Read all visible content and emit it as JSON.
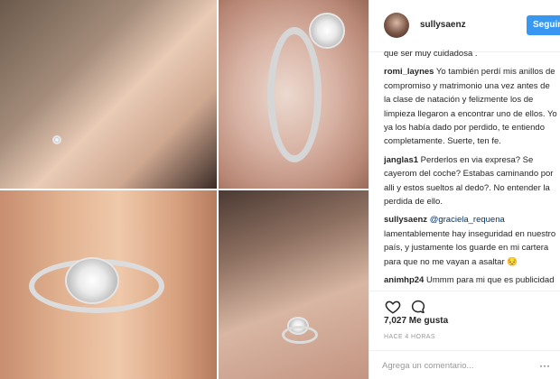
{
  "post": {
    "username": "sullysaenz",
    "follow_label": "Seguir",
    "likes": "7,027 Me gusta",
    "timestamp": "HACE 4 HORAS",
    "comment_placeholder": "Agrega un comentario...",
    "more_label": "···"
  },
  "comments": [
    {
      "user": "",
      "text": "que ser muy cuidadosa ."
    },
    {
      "user": "romi_laynes",
      "text": "Yo también perdí mis anillos de compromiso y matrimonio una vez antes de la clase de natación y felizmente los de limpieza llegaron a encontrar uno de ellos. Yo ya los había dado por perdido, te entiendo completamente. Suerte, ten fe."
    },
    {
      "user": "janglas1",
      "text": "Perderlos en via expresa? Se cayerom del coche? Estabas caminando por alli y estos sueltos al dedo?. No entender la perdida de ello."
    },
    {
      "user": "sullysaenz",
      "mention": "@graciela_requena",
      "text": "lamentablemente hay inseguridad en nuestro país, y justamente los guarde en mi cartera para que no me vayan a asaltar 😔"
    },
    {
      "user": "animhp24",
      "text": "Ummm para mi que es publicidad para ub nuevo proyecto ya q a tula primero se le perdio y ahora a sully quien sigue ???? Espero no estar equivocada"
    }
  ],
  "icons": {
    "like": "heart-icon",
    "comment": "speech-bubble-icon",
    "more": "more-icon"
  },
  "colors": {
    "accent": "#3897f0",
    "text": "#262626",
    "muted": "#999999",
    "mention": "#003569"
  }
}
